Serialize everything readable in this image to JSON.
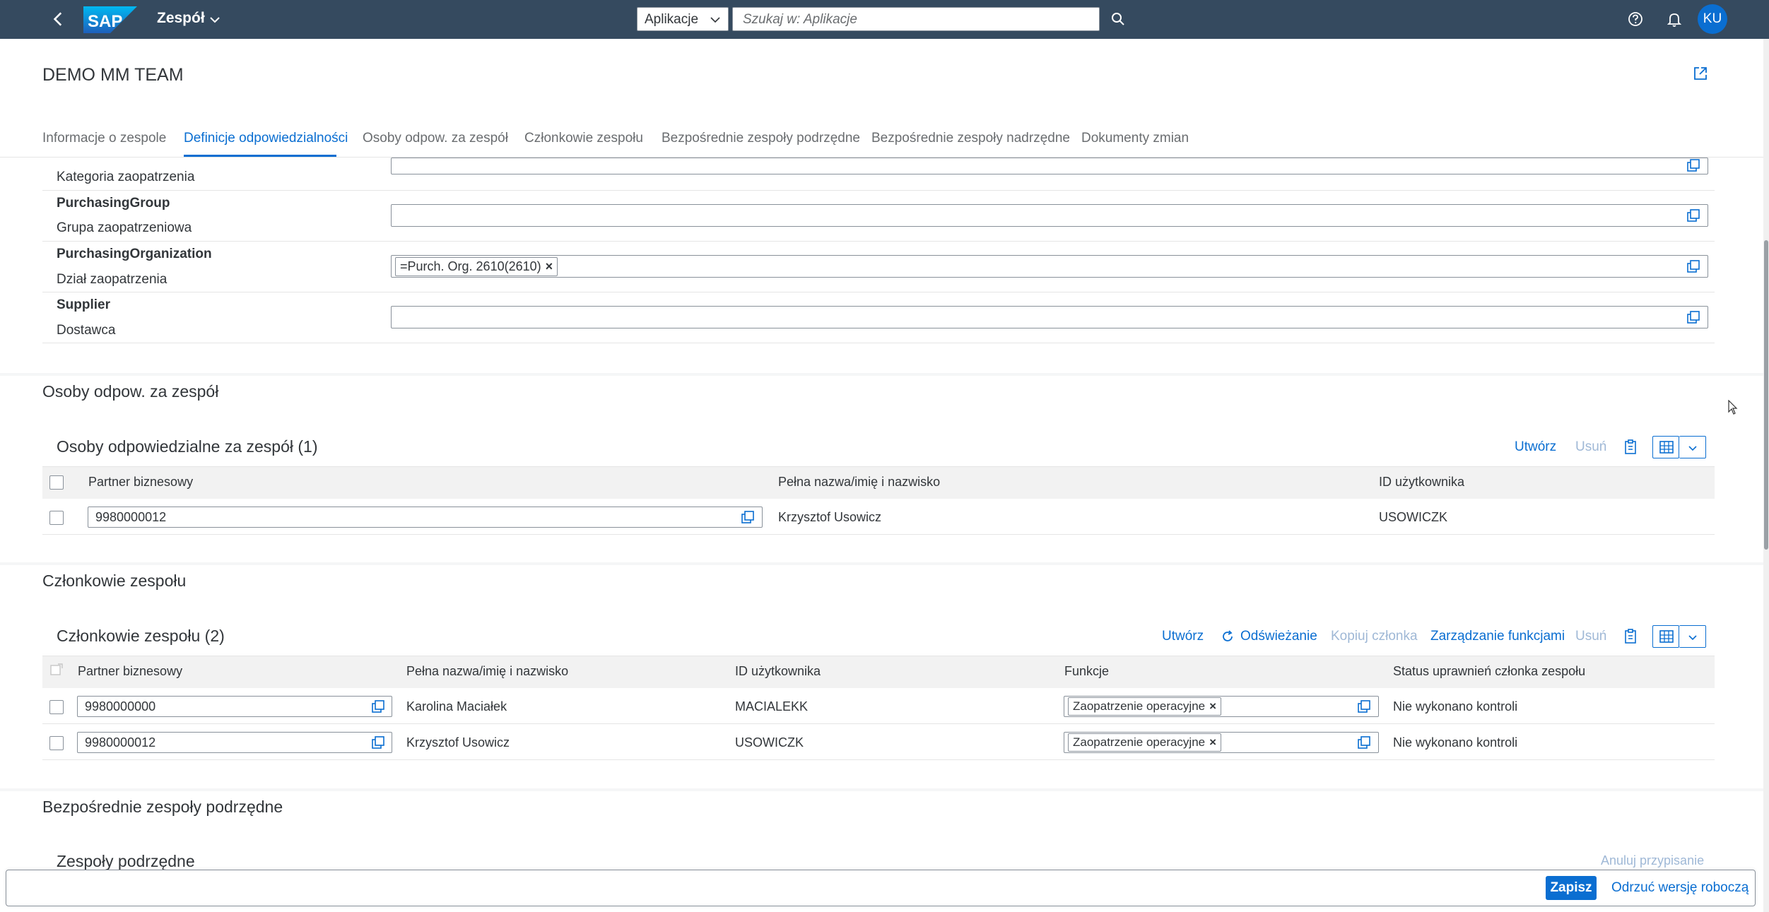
{
  "shell": {
    "title": "Zespół",
    "app_select": "Aplikacje",
    "search_placeholder": "Szukaj w: Aplikacje",
    "avatar_initials": "KU",
    "logo_text": "SAP"
  },
  "header": {
    "title": "DEMO MM TEAM",
    "tabs": [
      {
        "label": "Informacje o zespole"
      },
      {
        "label": "Definicje odpowiedzialności"
      },
      {
        "label": "Osoby odpow. za zespół"
      },
      {
        "label": "Członkowie zespołu"
      },
      {
        "label": "Bezpośrednie zespoły podrzędne"
      },
      {
        "label": "Bezpośrednie zespoły nadrzędne"
      },
      {
        "label": "Dokumenty zmian"
      }
    ]
  },
  "definitions": {
    "rows": [
      {
        "tech": "",
        "desc": "Kategoria zaopatrzenia",
        "value": ""
      },
      {
        "tech": "PurchasingGroup",
        "desc": "Grupa zaopatrzeniowa",
        "value": ""
      },
      {
        "tech": "PurchasingOrganization",
        "desc": "Dział zaopatrzenia",
        "token": "=Purch. Org. 2610(2610)"
      },
      {
        "tech": "Supplier",
        "desc": "Dostawca",
        "value": ""
      }
    ]
  },
  "responsible": {
    "section_title": "Osoby odpow. za zespół",
    "table_title": "Osoby odpowiedzialne za zespół (1)",
    "create_label": "Utwórz",
    "delete_label": "Usuń",
    "columns": [
      "Partner biznesowy",
      "Pełna nazwa/imię i nazwisko",
      "ID użytkownika"
    ],
    "rows": [
      {
        "partner": "9980000012",
        "name": "Krzysztof Usowicz",
        "user_id": "USOWICZK"
      }
    ]
  },
  "members": {
    "section_title": "Członkowie zespołu",
    "table_title": "Członkowie zespołu (2)",
    "create_label": "Utwórz",
    "refresh_label": "Odświeżanie",
    "copy_label": "Kopiuj członka",
    "manage_label": "Zarządzanie funkcjami",
    "delete_label": "Usuń",
    "columns": [
      "Partner biznesowy",
      "Pełna nazwa/imię i nazwisko",
      "ID użytkownika",
      "Funkcje",
      "Status uprawnień członka zespołu"
    ],
    "rows": [
      {
        "partner": "9980000000",
        "name": "Karolina Maciałek",
        "user_id": "MACIALEKK",
        "function": "Zaopatrzenie operacyjne",
        "status": "Nie wykonano kontroli"
      },
      {
        "partner": "9980000012",
        "name": "Krzysztof Usowicz",
        "user_id": "USOWICZK",
        "function": "Zaopatrzenie operacyjne",
        "status": "Nie wykonano kontroli"
      }
    ]
  },
  "subordinate": {
    "section_title": "Bezpośrednie zespoły podrzędne",
    "table_title": "Zespoły podrzędne",
    "unassign_label": "Anuluj przypisanie"
  },
  "footer": {
    "save_label": "Zapisz",
    "discard_label": "Odrzuć wersję roboczą"
  },
  "colors": {
    "shell": "#354a5f",
    "accent": "#0a6ed1",
    "disabled": "#9fb8d6"
  }
}
